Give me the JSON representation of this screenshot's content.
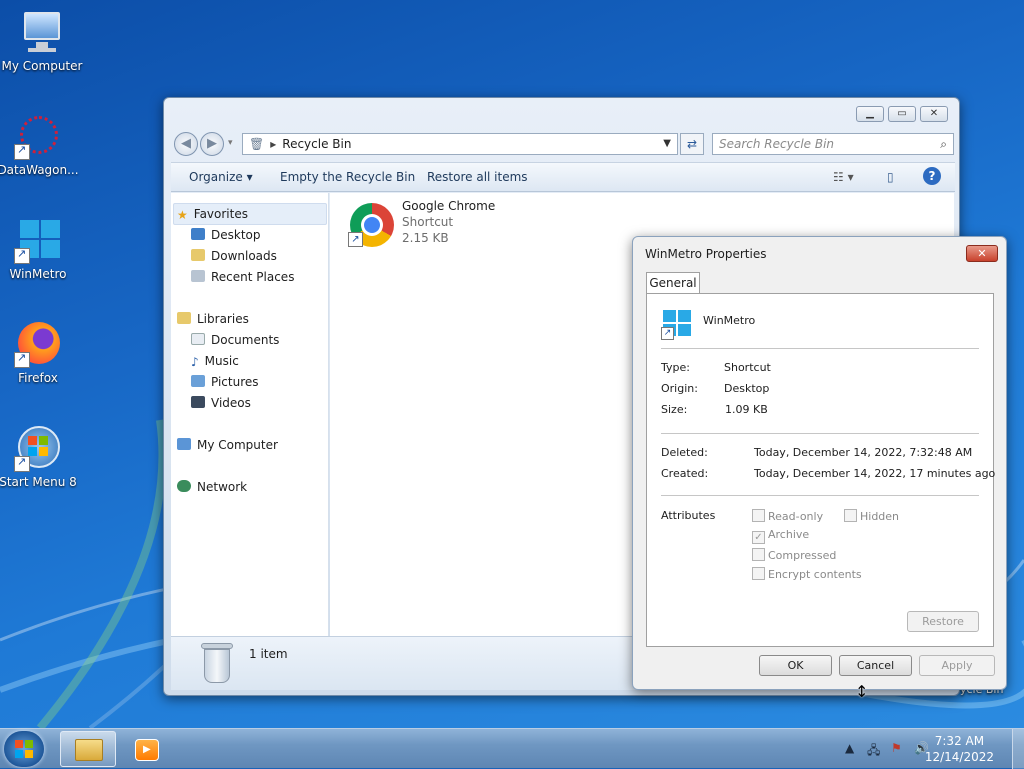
{
  "desktop": {
    "icons": [
      {
        "label": "My Computer"
      },
      {
        "label": "DataWagon..."
      },
      {
        "label": "WinMetro"
      },
      {
        "label": "Firefox"
      },
      {
        "label": "Start Menu 8"
      }
    ],
    "partial_label": "ycle Bin"
  },
  "explorer": {
    "address": "Recycle Bin",
    "search_placeholder": "Search Recycle Bin",
    "commands": {
      "organize": "Organize ▾",
      "empty": "Empty the Recycle Bin",
      "restore_all": "Restore all items"
    },
    "nav": {
      "favorites": "Favorites",
      "favorite_items": [
        "Desktop",
        "Downloads",
        "Recent Places"
      ],
      "libraries": "Libraries",
      "library_items": [
        "Documents",
        "Music",
        "Pictures",
        "Videos"
      ],
      "computer": "My Computer",
      "network": "Network"
    },
    "file": {
      "name": "Google Chrome",
      "type": "Shortcut",
      "size": "2.15 KB"
    },
    "status": {
      "count": "1 item"
    }
  },
  "properties": {
    "title": "WinMetro Properties",
    "tab": "General",
    "name": "WinMetro",
    "type_label": "Type:",
    "type_value": "Shortcut",
    "origin_label": "Origin:",
    "origin_value": "Desktop",
    "size_label": "Size:",
    "size_value": "1.09 KB",
    "deleted_label": "Deleted:",
    "deleted_value": "Today, December 14, 2022, 7:32:48 AM",
    "created_label": "Created:",
    "created_value": "Today, December 14, 2022, 17 minutes ago",
    "attributes_label": "Attributes",
    "attributes": {
      "readonly": "Read-only",
      "hidden": "Hidden",
      "archive": "Archive",
      "compressed": "Compressed",
      "encrypt": "Encrypt contents"
    },
    "restore": "Restore",
    "ok": "OK",
    "cancel": "Cancel",
    "apply": "Apply"
  },
  "taskbar": {
    "time": "7:32 AM",
    "date": "12/14/2022"
  }
}
